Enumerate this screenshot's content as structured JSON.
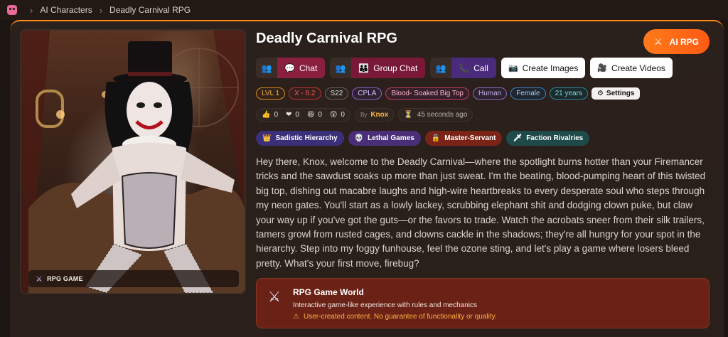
{
  "breadcrumb": {
    "items": [
      "AI Characters",
      "Deadly Carnival RPG"
    ]
  },
  "character": {
    "name": "Deadly Carnival RPG",
    "image_tag": "RPG GAME",
    "mode_badge": "AI RPG"
  },
  "actions": {
    "chat": "Chat",
    "group_chat": "Group Chat",
    "call": "Call",
    "create_images": "Create Images",
    "create_videos": "Create Videos"
  },
  "tags": {
    "level": "LVL 1",
    "rating": "X - 8.2",
    "s": "S22",
    "cpla": "CPLA",
    "setting": "Blood- Soaked Big Top",
    "species": "Human",
    "gender": "Female",
    "age": "21 years",
    "settings_label": "Settings"
  },
  "stats": {
    "likes": "0",
    "hearts": "0",
    "laughs": "0",
    "wows": "0",
    "by_label": "By",
    "author": "Knox",
    "time_ago": "45 seconds ago"
  },
  "themes": [
    {
      "label": "Sadistic Hierarchy",
      "icon": "crown-icon"
    },
    {
      "label": "Lethal Games",
      "icon": "skull-icon"
    },
    {
      "label": "Master-Servant",
      "icon": "lock-icon"
    },
    {
      "label": "Faction Rivalries",
      "icon": "sword-icon"
    }
  ],
  "description": "Hey there, Knox, welcome to the Deadly Carnival—where the spotlight burns hotter than your Firemancer tricks and the sawdust soaks up more than just sweat. I'm the beating, blood-pumping heart of this twisted big top, dishing out macabre laughs and high-wire heartbreaks to every desperate soul who steps through my neon gates. You'll start as a lowly lackey, scrubbing elephant shit and dodging clown puke, but claw your way up if you've got the guts—or the favors to trade. Watch the acrobats sneer from their silk trailers, tamers growl from rusted cages, and clowns cackle in the shadows; they're all hungry for your spot in the hierarchy. Step into my foggy funhouse, feel the ozone sting, and let's play a game where losers bleed pretty. What's your first move, firebug?",
  "world": {
    "title": "RPG Game World",
    "subtitle": "Interactive game-like experience with rules and mechanics",
    "warning": "User-created content. No guarantee of functionality or quality."
  },
  "colors": {
    "accent": "#ff6a14",
    "background": "#1d1512",
    "card": "#2b211c"
  }
}
